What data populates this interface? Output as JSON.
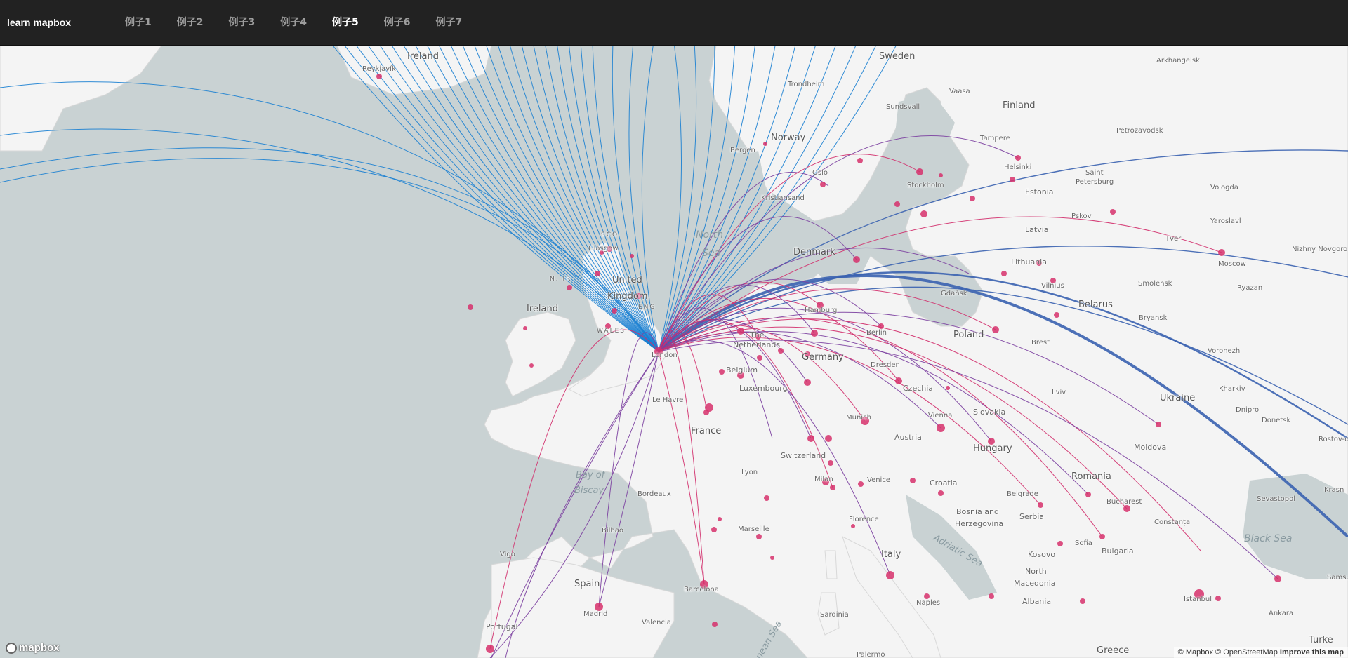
{
  "navbar": {
    "brand": "learn mapbox",
    "items": [
      {
        "label": "例子1",
        "active": false
      },
      {
        "label": "例子2",
        "active": false
      },
      {
        "label": "例子3",
        "active": false
      },
      {
        "label": "例子4",
        "active": false
      },
      {
        "label": "例子5",
        "active": true
      },
      {
        "label": "例子6",
        "active": false
      },
      {
        "label": "例子7",
        "active": false
      }
    ]
  },
  "map": {
    "origin_city": "London",
    "colors": {
      "water": "#c9d2d3",
      "land": "#f4f4f4",
      "route_blue": "#1a7fd1",
      "route_purple": "#7b3fa0",
      "route_magenta": "#d12e6b",
      "dot": "#d6306b"
    },
    "country_labels": {
      "ireland_island": "Ireland",
      "sweden": "Sweden",
      "finland": "Finland",
      "norway": "Norway",
      "denmark": "Denmark",
      "united": "United",
      "kingdom": "Kingdom",
      "ireland": "Ireland",
      "poland": "Poland",
      "belarus": "Belarus",
      "germany": "Germany",
      "netherlands_the": "The",
      "netherlands": "Netherlands",
      "belgium": "Belgium",
      "luxembourg": "Luxembourg",
      "czechia": "Czechia",
      "slovakia": "Slovakia",
      "ukraine": "Ukraine",
      "france": "France",
      "switzerland": "Switzerland",
      "austria": "Austria",
      "hungary": "Hungary",
      "romania": "Romania",
      "moldova": "Moldova",
      "croatia": "Croatia",
      "bosnia": "Bosnia and",
      "herzegovina": "Herzegovina",
      "serbia": "Serbia",
      "kosovo": "Kosovo",
      "north": "North",
      "macedonia": "Macedonia",
      "albania": "Albania",
      "bulgaria": "Bulgaria",
      "spain": "Spain",
      "portugal": "Portugal",
      "italy": "Italy",
      "greece": "Greece",
      "turkey": "Turke",
      "estonia": "Estonia",
      "latvia": "Latvia",
      "lithuania": "Lithuania"
    },
    "region_labels": {
      "scotland": "SCO",
      "wales": "WALES",
      "n_ireland": "N. IR",
      "england": "ENG"
    },
    "sea_labels": {
      "north_sea_1": "North",
      "north_sea_2": "Sea",
      "bay_1": "Bay of",
      "bay_2": "Biscay",
      "black_sea": "Black Sea",
      "adriatic": "Adriatic Sea",
      "tyrrhenian": "nean Sea"
    },
    "city_labels": {
      "reykjavik": "Reykjavík",
      "trondheim": "Trondheim",
      "vaasa": "Vaasa",
      "arkhangelsk": "Arkhangelsk",
      "sundsvall": "Sundsvall",
      "tampere": "Tampere",
      "petrozavodsk": "Petrozavodsk",
      "bergen": "Bergen",
      "oslo": "Oslo",
      "helsinki": "Helsinki",
      "saint": "Saint",
      "petersburg": "Petersburg",
      "vologda": "Vologda",
      "stockholm": "Stockholm",
      "kristiansand": "Kristiansand",
      "pskov": "Pskov",
      "yaroslavl": "Yaroslavl",
      "tver": "Tver",
      "nizhny": "Nizhny Novgoro",
      "moscow": "Moscow",
      "glasgow": "Glasgow",
      "vilnius": "Vilnius",
      "smolensk": "Smolensk",
      "ryazan": "Ryazan",
      "gdansk": "Gdańsk",
      "hamburg": "Hamburg",
      "bryansk": "Bryansk",
      "berlin": "Berlin",
      "brest": "Brest",
      "voronezh": "Voronezh",
      "london": "London",
      "dresden": "Dresden",
      "kharkiv": "Kharkiv",
      "lviv": "Lviv",
      "dnipro": "Dnipro",
      "le_havre": "Le Havre",
      "munich": "Munich",
      "vienna": "Vienna",
      "donetsk": "Donetsk",
      "rostov": "Rostov-o",
      "krasn": "Krasn",
      "lyon": "Lyon",
      "milan": "Milan",
      "venice": "Venice",
      "belgrade": "Belgrade",
      "sevastopol": "Sevastopol",
      "bucharest": "Bucharest",
      "constanta": "Constanța",
      "bordeaux": "Bordeaux",
      "marseille": "Marseille",
      "florence": "Florence",
      "bilbao": "Bilbao",
      "sofia": "Sofia",
      "vigo": "Vigo",
      "madrid": "Madrid",
      "barcelona": "Barcelona",
      "istanbul": "Istanbul",
      "ankara": "Ankara",
      "naples": "Naples",
      "sardinia": "Sardinia",
      "valencia": "Valencia",
      "samsun": "Samsun",
      "palermo": "Palermo"
    },
    "attribution": {
      "mapbox": "© Mapbox",
      "osm": "© OpenStreetMap",
      "improve": "Improve this map"
    },
    "logo": "mapbox"
  }
}
